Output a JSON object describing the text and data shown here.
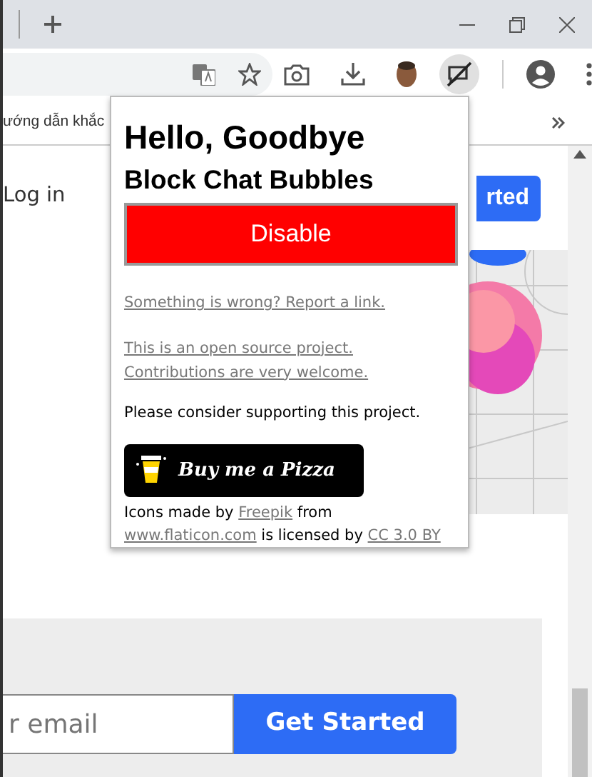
{
  "browser": {
    "extension_active": true,
    "bookmark": "ướng dẫn khắc"
  },
  "page": {
    "login": "Log in",
    "header_button": "rted",
    "email_placeholder": "r email",
    "cta": "Get Started"
  },
  "popup": {
    "title": "Hello, Goodbye",
    "subtitle": "Block Chat Bubbles",
    "toggle_button": "Disable",
    "report_link": "Something is wrong? Report a link.",
    "open_source_link": [
      "This is an open source project.",
      "Contributions are very welcome."
    ],
    "support_text": "Please consider supporting this project.",
    "pizza_button": "Buy me a Pizza",
    "credits": [
      {
        "kind": "text",
        "text": "Icons made by "
      },
      {
        "kind": "link",
        "text": "Freepik"
      },
      {
        "kind": "text",
        "text": " from "
      },
      {
        "kind": "link",
        "text": "www.flaticon.com"
      },
      {
        "kind": "text",
        "text": " is licensed by "
      },
      {
        "kind": "link",
        "text": "CC 3.0 BY"
      }
    ]
  }
}
